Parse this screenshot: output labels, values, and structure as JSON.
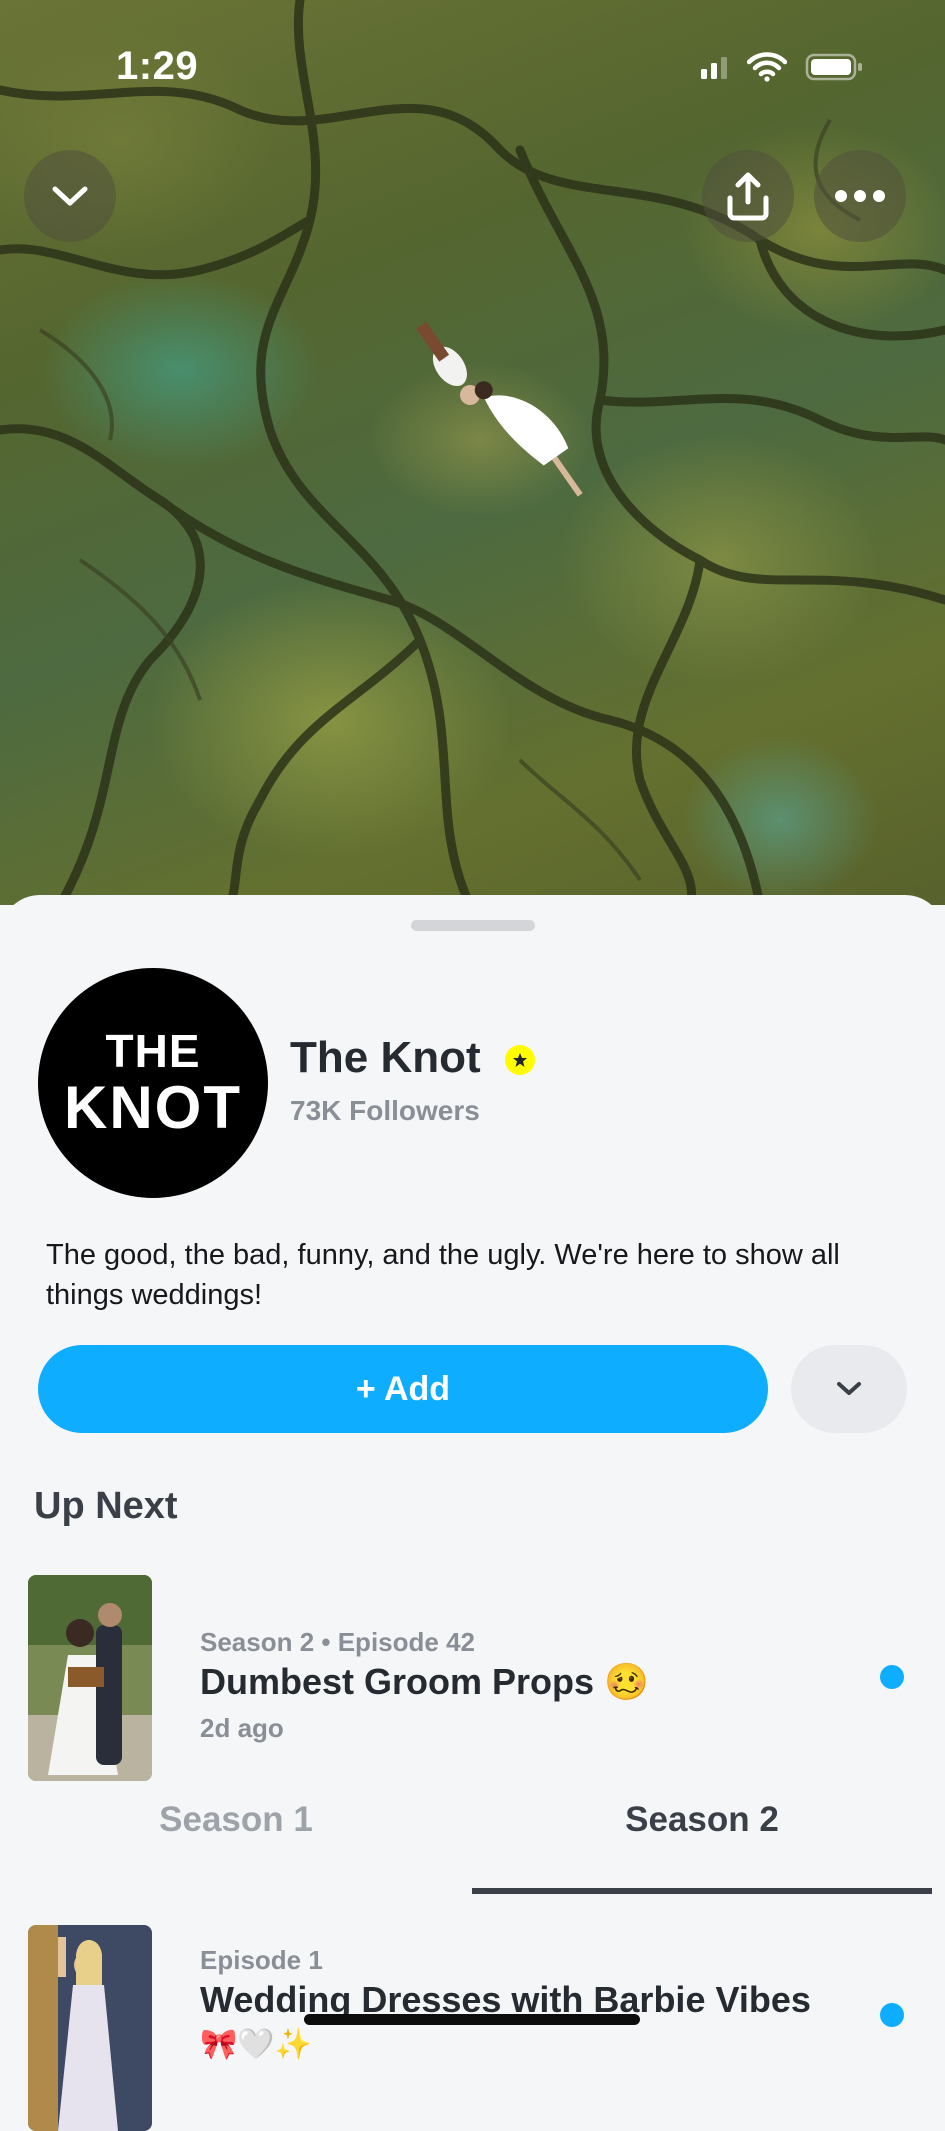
{
  "status_bar": {
    "time": "1:29"
  },
  "hero": {
    "top_controls": [
      "chevron-down-icon",
      "share-icon",
      "more-icon"
    ]
  },
  "channel": {
    "logo_line1": "THE",
    "logo_line2": "KNOT",
    "name": "The Knot",
    "followers": "73K Followers",
    "description": "The good, the bad, funny, and the ugly. We're here to show all things weddings!",
    "verified_color": "#fffc00"
  },
  "actions": {
    "add_label": "+ Add"
  },
  "up_next": {
    "title": "Up Next",
    "episode": {
      "meta": "Season 2 • Episode 42",
      "title": "Dumbest Groom Props 🥴",
      "age": "2d ago"
    }
  },
  "seasons": {
    "tabs": [
      "Season 1",
      "Season 2"
    ],
    "selected": "Season 2"
  },
  "episodes": [
    {
      "meta": "Episode 1",
      "title": "Wedding Dresses with Barbie Vibes",
      "subtitle": "🎀🤍✨"
    }
  ],
  "colors": {
    "accent": "#0fadff",
    "unread_dot": "#0fadff"
  }
}
